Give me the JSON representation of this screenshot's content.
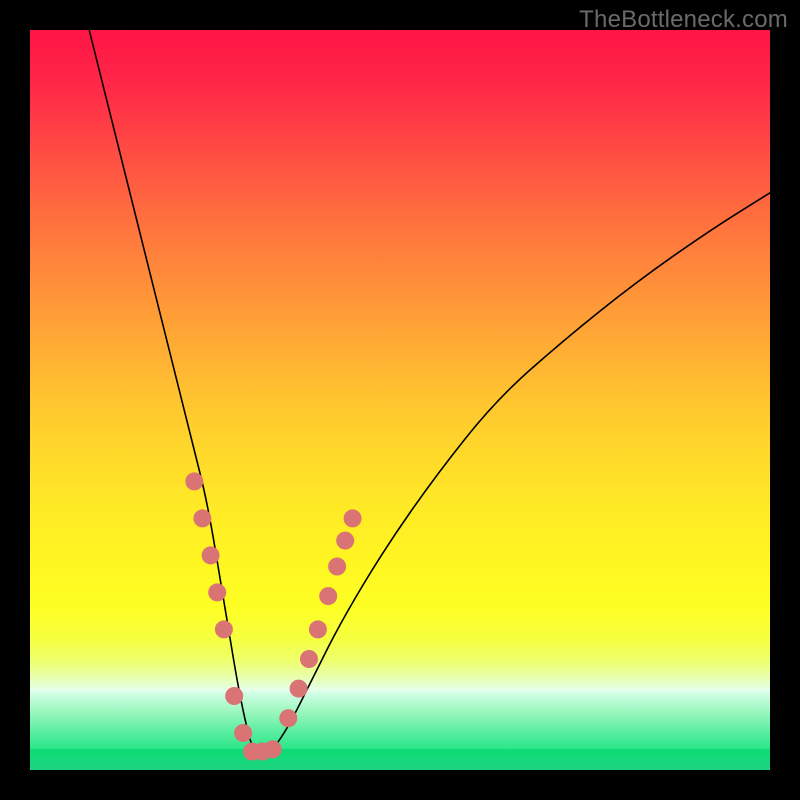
{
  "watermark_text": "TheBottleneck.com",
  "chart_data": {
    "type": "line",
    "title": "",
    "xlabel": "",
    "ylabel": "",
    "xlim": [
      0,
      100
    ],
    "ylim": [
      0,
      100
    ],
    "grid": false,
    "legend": false,
    "background": {
      "gradient_colors_top_to_bottom": [
        "#ff1446",
        "#ff4a43",
        "#ff873b",
        "#ffbe31",
        "#ffe926",
        "#fdff24",
        "#e6ffd0",
        "#2be68a",
        "#0fda78"
      ],
      "description": "vertical rainbow gradient red→orange→yellow→pale→green with a thin deep-green line near the bottom"
    },
    "series": [
      {
        "name": "bottleneck-curve",
        "stroke": "#000000",
        "stroke_width": 1.6,
        "x": [
          8,
          10,
          12,
          14,
          16,
          18,
          20,
          22,
          24,
          26,
          27,
          28,
          29,
          30,
          31,
          32,
          33,
          35,
          38,
          42,
          48,
          55,
          63,
          72,
          82,
          92,
          100
        ],
        "y": [
          100,
          92,
          84,
          76,
          68,
          60,
          52,
          44,
          36,
          24,
          18,
          12,
          7,
          3,
          2,
          2,
          3,
          6,
          12,
          20,
          30,
          40,
          50,
          58,
          66,
          73,
          78
        ]
      },
      {
        "name": "highlight-dots",
        "type": "scatter",
        "marker": "circle",
        "marker_color": "#da7373",
        "marker_radius_px": 9,
        "x": [
          22.2,
          23.3,
          24.4,
          25.3,
          26.2,
          27.6,
          28.8,
          30.0,
          31.4,
          32.8,
          34.9,
          36.3,
          37.7,
          38.9,
          40.3,
          41.5,
          42.6,
          43.6
        ],
        "y": [
          39.0,
          34.0,
          29.0,
          24.0,
          19.0,
          10.0,
          5.0,
          2.5,
          2.5,
          2.8,
          7.0,
          11.0,
          15.0,
          19.0,
          23.5,
          27.5,
          31.0,
          34.0
        ]
      }
    ],
    "annotations": [
      {
        "text": "TheBottleneck.com",
        "position": "top-right",
        "color": "#6a6a6a"
      }
    ]
  }
}
